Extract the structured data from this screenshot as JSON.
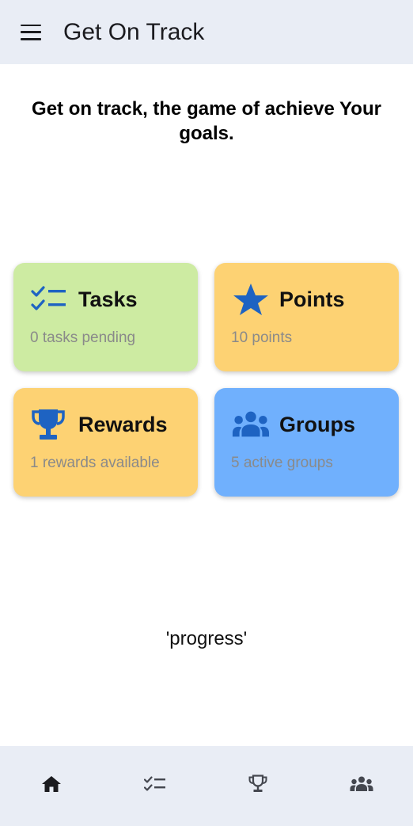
{
  "app_bar": {
    "title": "Get On Track",
    "menu_icon": "menu-icon"
  },
  "headline": "Get on track, the game of achieve Your goals.",
  "cards": {
    "tasks": {
      "title": "Tasks",
      "subtitle": "0 tasks pending",
      "icon": "checklist-icon",
      "color": "#cdeba2",
      "icon_color": "#1e63c2"
    },
    "points": {
      "title": "Points",
      "subtitle": "10 points",
      "icon": "star-icon",
      "color": "#fdd273",
      "icon_color": "#1e63c2"
    },
    "rewards": {
      "title": "Rewards",
      "subtitle": "1 rewards available",
      "icon": "trophy-icon",
      "color": "#fdd273",
      "icon_color": "#1e63c2"
    },
    "groups": {
      "title": "Groups",
      "subtitle": "5 active groups",
      "icon": "groups-icon",
      "color": "#70b0fd",
      "icon_color": "#1e63c2"
    }
  },
  "progress_text": "'progress'",
  "bottom_nav": {
    "items": [
      {
        "icon": "home-icon",
        "active": true
      },
      {
        "icon": "checklist-icon",
        "active": false
      },
      {
        "icon": "trophy-icon",
        "active": false
      },
      {
        "icon": "groups-icon",
        "active": false
      }
    ],
    "active_color": "#1b1b1f",
    "inactive_color": "#44474f"
  }
}
